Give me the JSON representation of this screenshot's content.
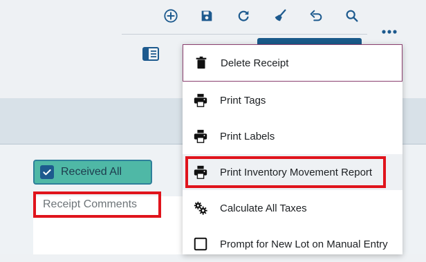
{
  "toolbar": {
    "icons": [
      "add-icon",
      "save-icon",
      "refresh-icon",
      "clear-icon",
      "undo-icon",
      "search-icon"
    ],
    "more": "more-icon",
    "panel_toggle": "panel-icon"
  },
  "form": {
    "received_all_label": "Received All",
    "received_all_checked": true,
    "comments_placeholder": "Receipt Comments"
  },
  "menu": {
    "items": [
      {
        "label": "Delete Receipt",
        "icon": "trash-icon"
      },
      {
        "label": "Print Tags",
        "icon": "printer-icon"
      },
      {
        "label": "Print Labels",
        "icon": "printer-icon"
      },
      {
        "label": "Print Inventory Movement Report",
        "icon": "printer-icon"
      },
      {
        "label": "Calculate All Taxes",
        "icon": "gears-icon"
      },
      {
        "label": "Prompt for New Lot on Manual Entry",
        "icon": "checkbox-icon"
      }
    ]
  },
  "colors": {
    "accent": "#1d5a8e",
    "received_bg": "#4fb8a6",
    "highlight": "#e0141c",
    "delete_border": "#8a3e6e"
  }
}
